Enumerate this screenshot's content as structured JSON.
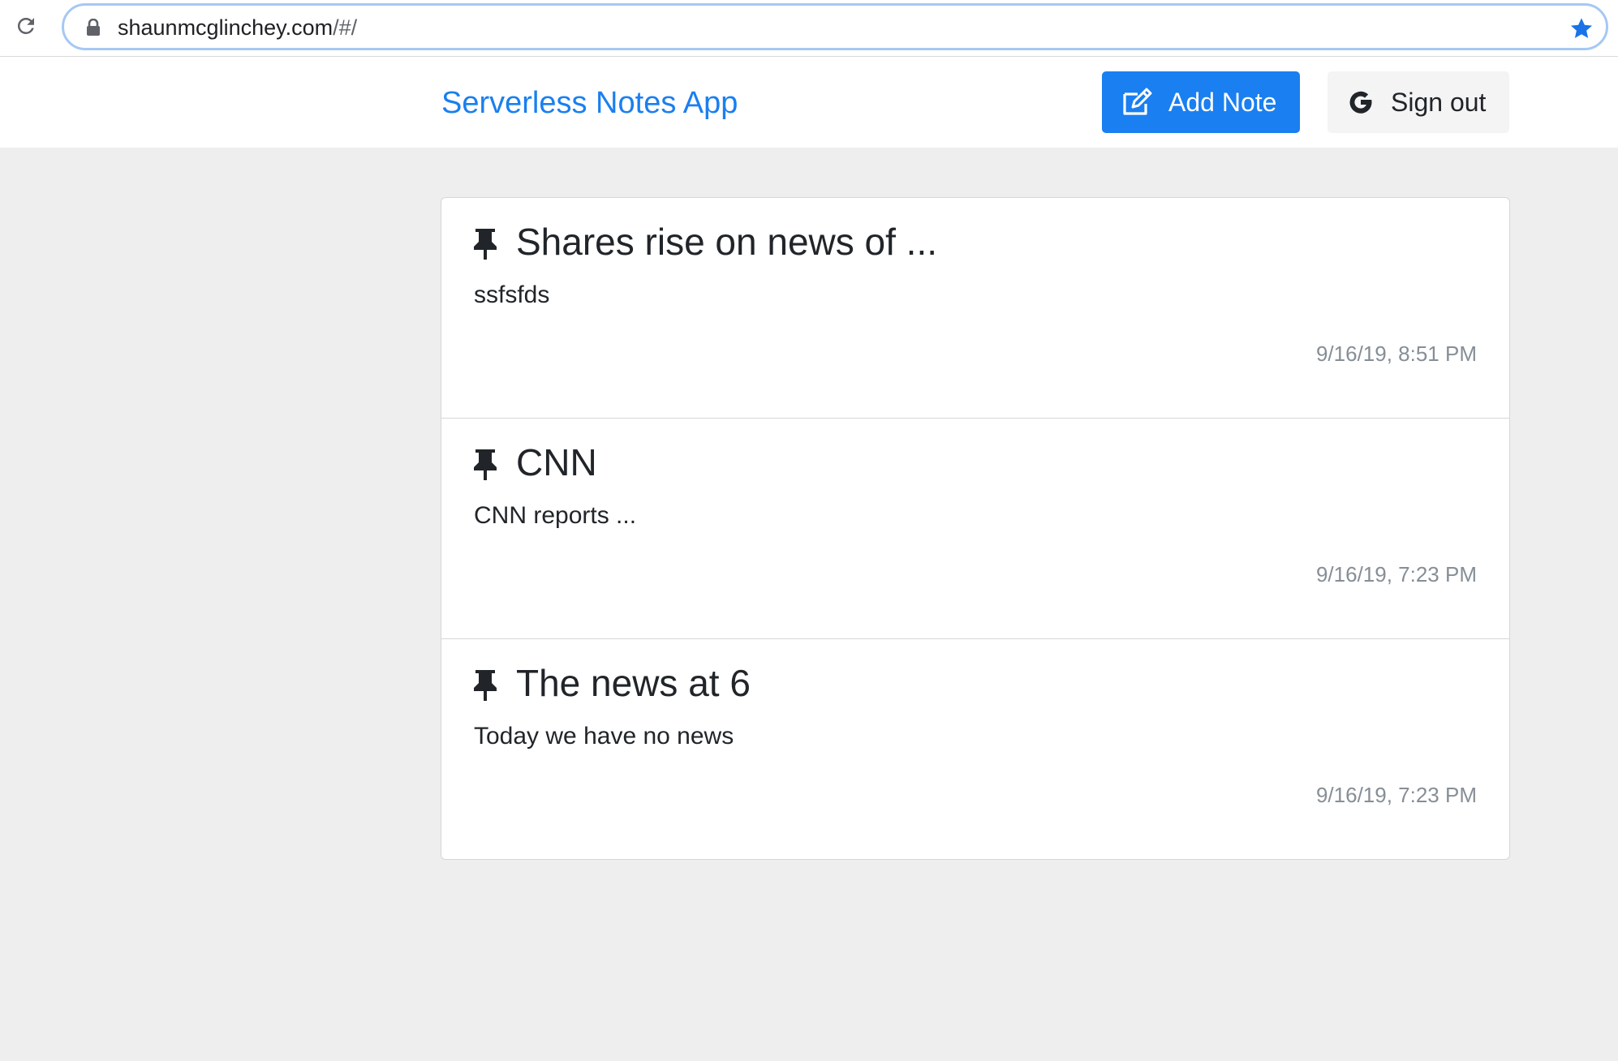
{
  "browser": {
    "url_host": "shaunmcglinchey.com",
    "url_path": "/#/",
    "icons": {
      "reload": "reload-icon",
      "lock": "lock-icon",
      "star": "bookmark-star-icon"
    },
    "colors": {
      "star": "#1a73e8",
      "focus_ring": "#a6c8f3"
    }
  },
  "header": {
    "brand": "Serverless Notes App",
    "add_note_label": "Add Note",
    "sign_out_label": "Sign out",
    "icons": {
      "add_note": "edit-icon",
      "sign_out": "google-icon"
    },
    "colors": {
      "primary": "#1a7ff0",
      "secondary_bg": "#f4f4f5"
    }
  },
  "notes": [
    {
      "title": "Shares rise on news of ...",
      "body": "ssfsfds",
      "time": "9/16/19, 8:51 PM",
      "icon": "pin-icon"
    },
    {
      "title": "CNN",
      "body": "CNN reports ...",
      "time": "9/16/19, 7:23 PM",
      "icon": "pin-icon"
    },
    {
      "title": "The news at 6",
      "body": "Today we have no news",
      "time": "9/16/19, 7:23 PM",
      "icon": "pin-icon"
    }
  ]
}
